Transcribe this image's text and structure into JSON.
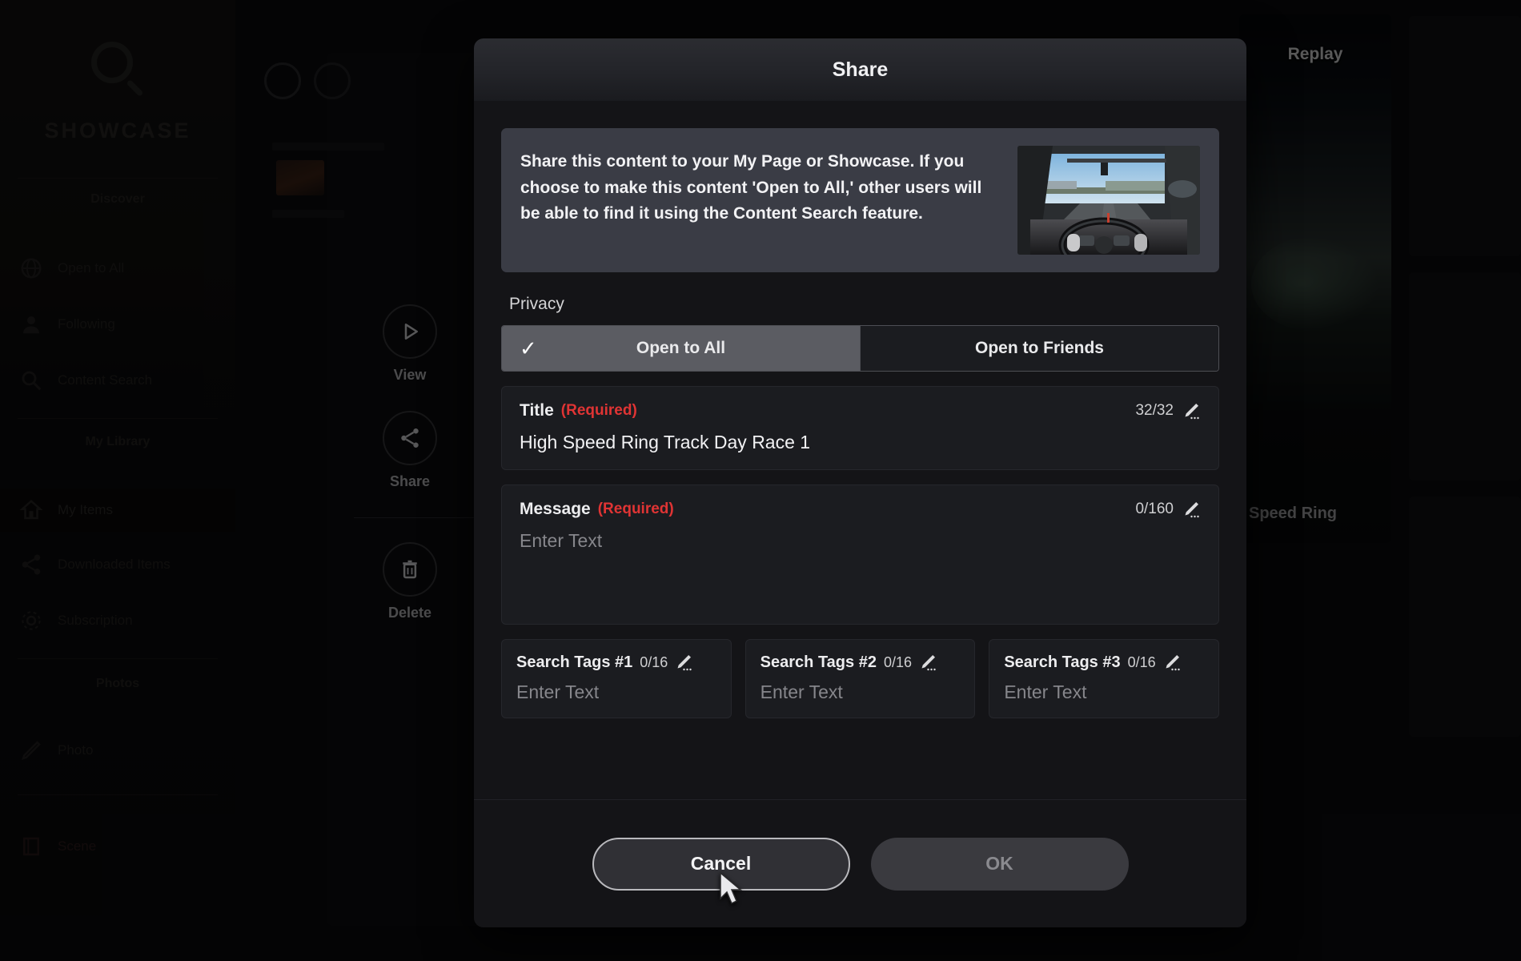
{
  "background": {
    "sidebar": {
      "search_icon": "search-icon",
      "brand": "SHOWCASE",
      "sections": [
        {
          "label": "Discover"
        },
        {
          "label": "My Library"
        },
        {
          "label": "Photos"
        }
      ],
      "items": [
        {
          "label": "Open to All",
          "icon": "globe-icon"
        },
        {
          "label": "Following",
          "icon": "person-icon"
        },
        {
          "label": "Content Search",
          "icon": "search-small-icon"
        },
        {
          "label": "My Items",
          "icon": "home-icon",
          "active": true
        },
        {
          "label": "Downloaded Items",
          "icon": "share-icon"
        },
        {
          "label": "Subscription",
          "icon": "gear-icon"
        },
        {
          "label": "Photo",
          "icon": "pencil-icon"
        },
        {
          "label": "Scene",
          "icon": "book-icon",
          "accent": "red"
        }
      ]
    },
    "rail": [
      {
        "label": "View",
        "icon": "play-icon"
      },
      {
        "label": "Share",
        "icon": "share-nodes-icon"
      },
      {
        "label": "Delete",
        "icon": "trash-icon"
      }
    ],
    "replay": {
      "label": "Replay",
      "caption": "gh Speed Ring"
    }
  },
  "modal": {
    "title": "Share",
    "description": "Share this content to your My Page or Showcase. If you choose to make this content 'Open to All,' other users will be able to find it using the Content Search feature.",
    "thumbnail_alt": "cockpit-view-thumbnail",
    "privacy": {
      "label": "Privacy",
      "options": [
        {
          "label": "Open to All",
          "selected": true
        },
        {
          "label": "Open to Friends",
          "selected": false
        }
      ]
    },
    "fields": {
      "title": {
        "name": "Title",
        "required_tag": "(Required)",
        "counter": "32/32",
        "value": "High Speed Ring Track Day Race 1",
        "edit_icon": "pencil-icon"
      },
      "message": {
        "name": "Message",
        "required_tag": "(Required)",
        "counter": "0/160",
        "placeholder": "Enter Text",
        "edit_icon": "pencil-icon"
      }
    },
    "tags": [
      {
        "name": "Search Tags #1",
        "counter": "0/16",
        "placeholder": "Enter Text",
        "edit_icon": "pencil-icon"
      },
      {
        "name": "Search Tags #2",
        "counter": "0/16",
        "placeholder": "Enter Text",
        "edit_icon": "pencil-icon"
      },
      {
        "name": "Search Tags #3",
        "counter": "0/16",
        "placeholder": "Enter Text",
        "edit_icon": "pencil-icon"
      }
    ],
    "footer": {
      "cancel_label": "Cancel",
      "ok_label": "OK"
    }
  },
  "colors": {
    "required_red": "#e03434",
    "segment_selected": "#5b5c62",
    "dialog_bg": "#141417",
    "desc_card_bg": "#3a3c45"
  }
}
